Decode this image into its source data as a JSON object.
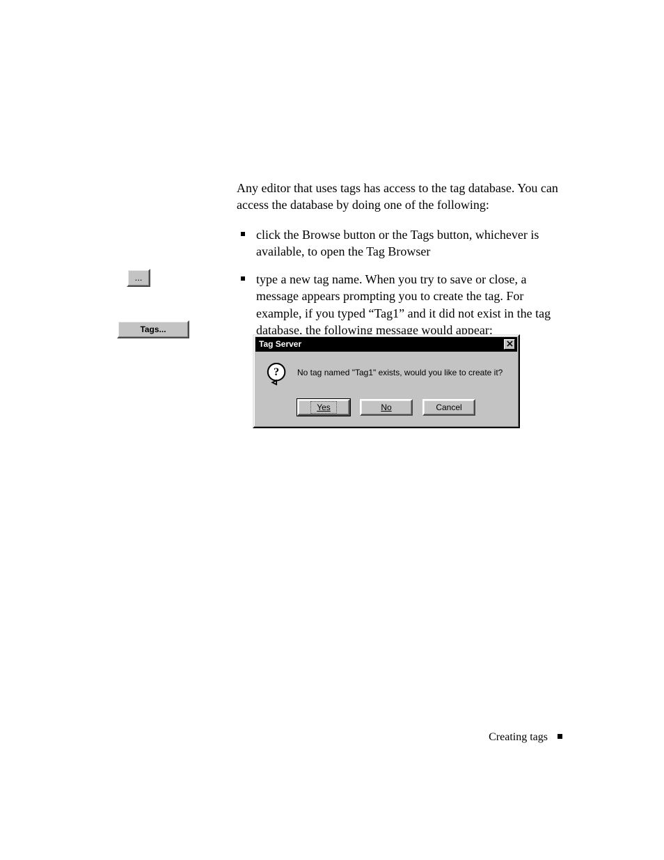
{
  "body": {
    "intro": "Any editor that uses tags has access to the tag database. You can access the database by doing one of the following:",
    "bullets": [
      "click the Browse button or the Tags button, whichever is available, to open the Tag Browser",
      "type a new tag name. When you try to save or close, a message appears prompting you to create the tag. For example, if you typed “Tag1” and it did not exist in the tag database, the following message would appear:"
    ]
  },
  "margin_buttons": {
    "browse_label": "...",
    "tags_label": "Tags..."
  },
  "dialog": {
    "title": "Tag Server",
    "message": "No tag named \"Tag1\" exists, would you like to create it?",
    "buttons": {
      "yes": "Yes",
      "no": "No",
      "cancel": "Cancel"
    }
  },
  "footer": "Creating tags"
}
